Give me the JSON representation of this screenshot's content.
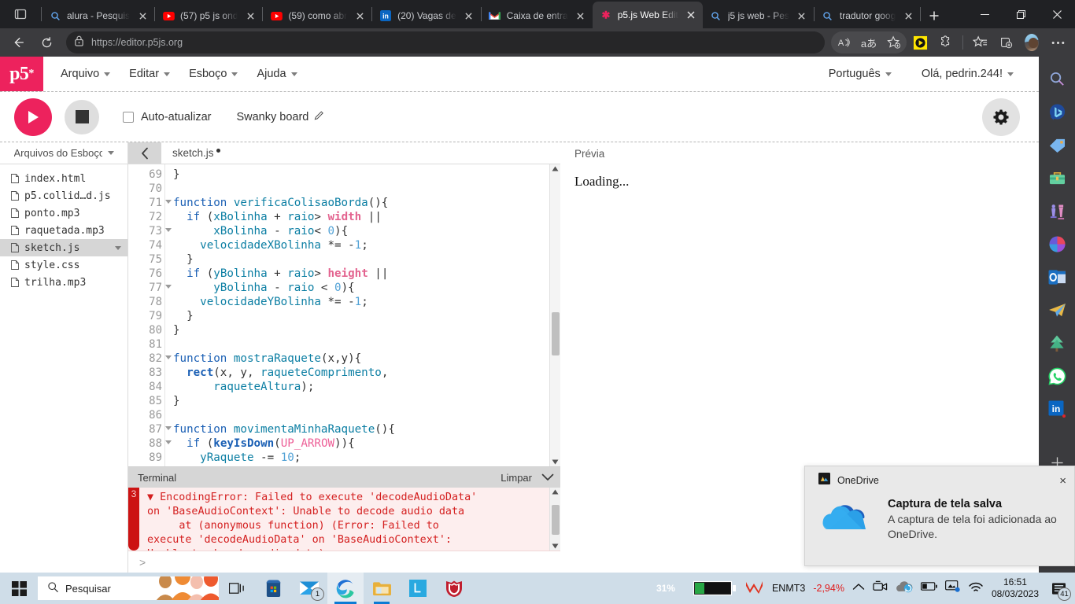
{
  "browser": {
    "tabs": [
      {
        "favicon": "search-icon",
        "title": "alura - Pesquis",
        "active": false
      },
      {
        "favicon": "youtube-icon",
        "title": "(57) p5 js ond",
        "active": false
      },
      {
        "favicon": "youtube-icon",
        "title": "(59) como abr",
        "active": false
      },
      {
        "favicon": "linkedin-icon",
        "title": "(20) Vagas de",
        "active": false
      },
      {
        "favicon": "gmail-icon",
        "title": "Caixa de entra",
        "active": false
      },
      {
        "favicon": "p5-icon",
        "title": "p5.js Web Edit",
        "active": true
      },
      {
        "favicon": "search-icon",
        "title": "j5 js web - Pes",
        "active": false
      },
      {
        "favicon": "search-icon",
        "title": "tradutor goog",
        "active": false
      }
    ],
    "url": "https://editor.p5js.org",
    "toolbar_icons": [
      "read-aloud-icon",
      "translate-icon",
      "add-favorite-icon",
      "media-player-icon",
      "extensions-icon",
      "favorites-icon",
      "collections-icon",
      "profile-avatar",
      "more-options-icon"
    ],
    "window_controls": [
      "minimize-icon",
      "restore-icon",
      "close-icon"
    ],
    "sidebar_icons": [
      "search-icon",
      "bing-chat-icon",
      "shopping-icon",
      "tools-icon",
      "games-icon",
      "office-icon",
      "outlook-icon",
      "telegram-icon",
      "tree-icon",
      "whatsapp-icon",
      "linkedin-icon",
      "add-icon"
    ]
  },
  "p5": {
    "logo": "p5",
    "logo_sup": "*",
    "menu": [
      "Arquivo",
      "Editar",
      "Esboço",
      "Ajuda"
    ],
    "language": "Português",
    "greeting": "Olá, pedrin.244!",
    "toolbar": {
      "play": "play-button",
      "stop": "stop-button",
      "autoupdate_label": "Auto-atualizar",
      "autoupdate_checked": false,
      "sketch_name": "Swanky board",
      "settings": "gear-button"
    },
    "files_panel": {
      "header": "Arquivos do Esboço",
      "files": [
        {
          "name": "index.html",
          "selected": false
        },
        {
          "name": "p5.collid…d.js",
          "selected": false
        },
        {
          "name": "ponto.mp3",
          "selected": false
        },
        {
          "name": "raquetada.mp3",
          "selected": false
        },
        {
          "name": "sketch.js",
          "selected": true
        },
        {
          "name": "style.css",
          "selected": false
        },
        {
          "name": "trilha.mp3",
          "selected": false
        }
      ]
    },
    "editor": {
      "tab_name": "sketch.js",
      "unsaved": true,
      "first_line": 69,
      "lines": [
        {
          "n": 69,
          "fold": false,
          "tokens": [
            {
              "t": "}",
              "c": "pl"
            }
          ]
        },
        {
          "n": 70,
          "fold": false,
          "tokens": []
        },
        {
          "n": 71,
          "fold": true,
          "tokens": [
            {
              "t": "function ",
              "c": "kw"
            },
            {
              "t": "verificaColisaoBorda",
              "c": "fn"
            },
            {
              "t": "(){",
              "c": "pl"
            }
          ]
        },
        {
          "n": 72,
          "fold": false,
          "tokens": [
            {
              "t": "  ",
              "c": "pl"
            },
            {
              "t": "if",
              "c": "kw"
            },
            {
              "t": " (",
              "c": "pl"
            },
            {
              "t": "xBolinha",
              "c": "id"
            },
            {
              "t": " + ",
              "c": "pl"
            },
            {
              "t": "raio",
              "c": "id"
            },
            {
              "t": "> ",
              "c": "pl"
            },
            {
              "t": "width",
              "c": "gl"
            },
            {
              "t": " ||",
              "c": "pl"
            }
          ]
        },
        {
          "n": 73,
          "fold": true,
          "tokens": [
            {
              "t": "      ",
              "c": "pl"
            },
            {
              "t": "xBolinha",
              "c": "id"
            },
            {
              "t": " - ",
              "c": "pl"
            },
            {
              "t": "raio",
              "c": "id"
            },
            {
              "t": "< ",
              "c": "pl"
            },
            {
              "t": "0",
              "c": "num"
            },
            {
              "t": "){",
              "c": "pl"
            }
          ]
        },
        {
          "n": 74,
          "fold": false,
          "tokens": [
            {
              "t": "    ",
              "c": "pl"
            },
            {
              "t": "velocidadeXBolinha",
              "c": "id"
            },
            {
              "t": " *= -",
              "c": "pl"
            },
            {
              "t": "1",
              "c": "num"
            },
            {
              "t": ";",
              "c": "pl"
            }
          ]
        },
        {
          "n": 75,
          "fold": false,
          "tokens": [
            {
              "t": "  }",
              "c": "pl"
            }
          ]
        },
        {
          "n": 76,
          "fold": false,
          "tokens": [
            {
              "t": "  ",
              "c": "pl"
            },
            {
              "t": "if",
              "c": "kw"
            },
            {
              "t": " (",
              "c": "pl"
            },
            {
              "t": "yBolinha",
              "c": "id"
            },
            {
              "t": " + ",
              "c": "pl"
            },
            {
              "t": "raio",
              "c": "id"
            },
            {
              "t": "> ",
              "c": "pl"
            },
            {
              "t": "height",
              "c": "gl"
            },
            {
              "t": " ||",
              "c": "pl"
            }
          ]
        },
        {
          "n": 77,
          "fold": true,
          "tokens": [
            {
              "t": "      ",
              "c": "pl"
            },
            {
              "t": "yBolinha",
              "c": "id"
            },
            {
              "t": " - ",
              "c": "pl"
            },
            {
              "t": "raio",
              "c": "id"
            },
            {
              "t": " < ",
              "c": "pl"
            },
            {
              "t": "0",
              "c": "num"
            },
            {
              "t": "){",
              "c": "pl"
            }
          ]
        },
        {
          "n": 78,
          "fold": false,
          "tokens": [
            {
              "t": "    ",
              "c": "pl"
            },
            {
              "t": "velocidadeYBolinha",
              "c": "id"
            },
            {
              "t": " *= -",
              "c": "pl"
            },
            {
              "t": "1",
              "c": "num"
            },
            {
              "t": ";",
              "c": "pl"
            }
          ]
        },
        {
          "n": 79,
          "fold": false,
          "tokens": [
            {
              "t": "  }",
              "c": "pl"
            }
          ]
        },
        {
          "n": 80,
          "fold": false,
          "tokens": [
            {
              "t": "}",
              "c": "pl"
            }
          ]
        },
        {
          "n": 81,
          "fold": false,
          "tokens": []
        },
        {
          "n": 82,
          "fold": true,
          "tokens": [
            {
              "t": "function ",
              "c": "kw"
            },
            {
              "t": "mostraRaquete",
              "c": "fn"
            },
            {
              "t": "(x,y){",
              "c": "pl"
            }
          ]
        },
        {
          "n": 83,
          "fold": false,
          "tokens": [
            {
              "t": "  ",
              "c": "pl"
            },
            {
              "t": "rect",
              "c": "bld"
            },
            {
              "t": "(x, y, ",
              "c": "pl"
            },
            {
              "t": "raqueteComprimento",
              "c": "id"
            },
            {
              "t": ",",
              "c": "pl"
            }
          ]
        },
        {
          "n": 84,
          "fold": false,
          "tokens": [
            {
              "t": "      ",
              "c": "pl"
            },
            {
              "t": "raqueteAltura",
              "c": "id"
            },
            {
              "t": ");",
              "c": "pl"
            }
          ]
        },
        {
          "n": 85,
          "fold": false,
          "tokens": [
            {
              "t": "}",
              "c": "pl"
            }
          ]
        },
        {
          "n": 86,
          "fold": false,
          "tokens": []
        },
        {
          "n": 87,
          "fold": true,
          "tokens": [
            {
              "t": "function ",
              "c": "kw"
            },
            {
              "t": "movimentaMinhaRaquete",
              "c": "fn"
            },
            {
              "t": "(){",
              "c": "pl"
            }
          ]
        },
        {
          "n": 88,
          "fold": true,
          "tokens": [
            {
              "t": "  ",
              "c": "pl"
            },
            {
              "t": "if",
              "c": "kw"
            },
            {
              "t": " (",
              "c": "pl"
            },
            {
              "t": "keyIsDown",
              "c": "bld"
            },
            {
              "t": "(",
              "c": "pl"
            },
            {
              "t": "UP_ARROW",
              "c": "cst"
            },
            {
              "t": ")){",
              "c": "pl"
            }
          ]
        },
        {
          "n": 89,
          "fold": false,
          "tokens": [
            {
              "t": "    ",
              "c": "pl"
            },
            {
              "t": "yRaquete",
              "c": "id"
            },
            {
              "t": " -= ",
              "c": "pl"
            },
            {
              "t": "10",
              "c": "num"
            },
            {
              "t": ";",
              "c": "pl"
            }
          ]
        }
      ]
    },
    "terminal": {
      "title": "Terminal",
      "clear_label": "Limpar",
      "error_count": "3",
      "error_text": "▼ EncodingError: Failed to execute 'decodeAudioData'\non 'BaseAudioContext': Unable to decode audio data\n     at (anonymous function) (Error: Failed to\nexecute 'decodeAudioData' on 'BaseAudioContext':\nUnable to decode audio data)",
      "prompt": ">"
    },
    "preview": {
      "header": "Prévia",
      "content": "Loading..."
    }
  },
  "toast": {
    "app_name": "OneDrive",
    "title": "Captura de tela salva",
    "body": "A captura de tela foi adicionada ao OneDrive.",
    "close": "×"
  },
  "taskbar": {
    "search_placeholder": "Pesquisar",
    "items": [
      "task-view-icon",
      "microsoft-store-icon",
      "mail-icon",
      "edge-icon",
      "file-explorer-icon",
      "lightshot-icon",
      "mcafee-icon"
    ],
    "mail_badge": "1",
    "battery_percent": "31%",
    "stock_label": "ENMT3",
    "stock_change": "-2,94%",
    "time": "16:51",
    "date": "08/03/2023",
    "notification_count": "41",
    "tray_icons": [
      "show-hidden-icons-icon",
      "meet-now-icon",
      "onedrive-icon",
      "battery-icon",
      "display-icon",
      "wifi-icon"
    ]
  },
  "colors": {
    "p5_pink": "#ed225d",
    "error_red": "#d41f1f",
    "taskbar_blue": "#cfdde8",
    "accent_blue": "#0b7bd4"
  }
}
